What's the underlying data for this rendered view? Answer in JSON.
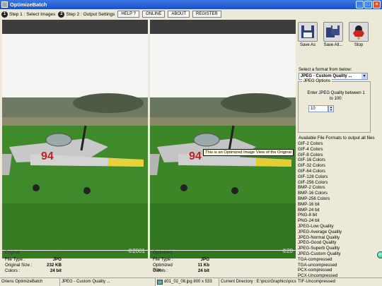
{
  "window": {
    "title": "OptimizeBatch",
    "min": "_",
    "max": "□",
    "close": "×"
  },
  "steps": [
    {
      "num": "1",
      "label": "Step 1 : Select Images"
    },
    {
      "num": "2",
      "label": "Step 2 : Output Settings"
    }
  ],
  "toolbar": {
    "help": "HELP ?",
    "online": "ONLINE",
    "about": "ABOUT",
    "register": "REGISTER"
  },
  "preview": {
    "copyright": "©2001",
    "copyright_right": "©20",
    "tooltip": "This is an Optimized Image View of the Original"
  },
  "original": {
    "caption": "Original",
    "file_type_label": "File Type :",
    "file_type": "JPG",
    "size_label": "Original Size :",
    "size": "232 KB",
    "colors_label": "Colors :",
    "colors": "24 bit"
  },
  "optimized": {
    "caption": "Optimized",
    "file_type_label": "File Type :",
    "file_type": "JPG",
    "size_label": "Optimized Size :",
    "size": "11 Kb",
    "colors_label": "Colors :",
    "colors": "24 bit"
  },
  "actions": {
    "save_as": "Save As",
    "save_all": "Save All...",
    "stop": "Stop"
  },
  "format": {
    "prompt": "Select a format from below:",
    "selected": "JPEG - Custom Quality ...",
    "group_title": "JPEG Options",
    "quality_desc": "Enter JPEG Quality between 1 to 100:",
    "quality_value": "10",
    "available_label": "Available File Formats to output all files",
    "list": [
      "GIF-2 Colors",
      "GIF-4 Colors",
      "GIF-8 Colors",
      "GIF-16 Colors",
      "GIF-32 Colors",
      "GIF-64 Colors",
      "GIF-128 Colors",
      "GIF-256 Colors",
      "BMP-2 Colors",
      "BMP-16 Colors",
      "BMP-256 Colors",
      "BMP-16 bit",
      "BMP-24 bit",
      "PNG-8 bit",
      "PNG-24 bit",
      "JPEG-Low Quality",
      "JPEG-Average Quality",
      "JPEG-Normal Quality",
      "JPEG-Good Quality",
      "JPEG-Superb Quality",
      "JPEG-Custom Quality",
      "TGA-compressed",
      "TGA-uncompressed",
      "PCX-compressed",
      "PCX-Uncompressed",
      "TIF-Uncompressed"
    ]
  },
  "status": {
    "app": "Oriens OptimizeBatch",
    "format": "JPEG - Custom Quality ...",
    "file": "d01_02_08.jpg 800 x 533",
    "dir": "Current Directory : E:\\pics\\Graphics\\pics"
  },
  "colors": {
    "title_bar": "#1b4fc4",
    "grass": "#3f8a2a",
    "sky": "#f4f4f2",
    "plane_body": "#c8c8c8",
    "plane_wing_tip": "#e8d23a",
    "marking": "#c02020"
  }
}
